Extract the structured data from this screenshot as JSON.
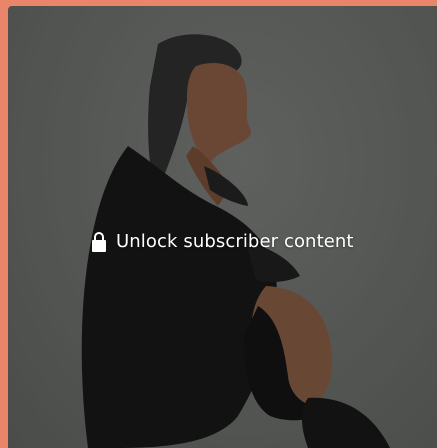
{
  "media": {
    "icon": "lock-icon",
    "overlay_text": "Unlock subscriber content"
  },
  "colors": {
    "page_background": "#e9856b",
    "photo_background": "#6f726f",
    "overlay_text": "#ffffff"
  }
}
